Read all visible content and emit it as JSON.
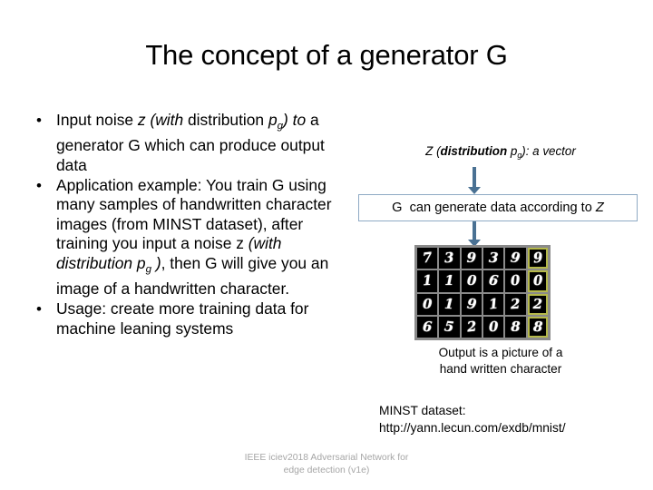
{
  "slide": {
    "title": "The concept of a generator G",
    "bullets": [
      {
        "id": "bullet-input-noise",
        "marker": "•",
        "segments": [
          {
            "text": "Input noise ",
            "style": "normal"
          },
          {
            "text": "z (with",
            "style": "italic"
          },
          {
            "text": " distribution ",
            "style": "normal"
          },
          {
            "text": "p",
            "style": "italic"
          },
          {
            "text": "g",
            "style": "sub"
          },
          {
            "text": ")",
            "style": "italic"
          },
          {
            "text": " ",
            "style": "normal"
          },
          {
            "text": "to",
            "style": "italic"
          },
          {
            "text": " a generator G which can produce output data",
            "style": "normal"
          }
        ],
        "plain": "Input noise z (with distribution pg) to a generator G which can produce output data"
      },
      {
        "id": "bullet-application-example",
        "marker": "•",
        "segments": [
          {
            "text": "Application example: You train G using many samples of handwritten character images (from MINST dataset), after training you input a noise z ",
            "style": "normal"
          },
          {
            "text": "(with distribution ",
            "style": "italic"
          },
          {
            "text": "p",
            "style": "italic"
          },
          {
            "text": "g",
            "style": "sub"
          },
          {
            "text": " )",
            "style": "italic"
          },
          {
            "text": ", then G will give you an image of a handwritten character.",
            "style": "normal"
          }
        ],
        "plain": "Application example: You train G using many samples of handwritten character images (from MINST dataset), after training you input a noise z (with distribution pg ), then G will give you an image of a handwritten character."
      },
      {
        "id": "bullet-usage",
        "marker": "•",
        "segments": [
          {
            "text": "Usage: create more training data for machine leaning systems",
            "style": "normal"
          }
        ],
        "plain": "Usage: create more training data for machine leaning systems"
      }
    ]
  },
  "diagram": {
    "z_label": {
      "prefix": "Z (",
      "bold": "distribution ",
      "p": "p",
      "sub": "g",
      "suffix": "): a vector",
      "plain": "Z (distribution pg): a vector"
    },
    "g_box": {
      "prefix": "G  can generate data according to ",
      "italic_tail": "Z",
      "plain": "G  can generate data according to Z",
      "border_color": "#8FAAC4"
    },
    "arrows": {
      "color": "#4A7193",
      "arrow_top_name": "arrow-z-to-g",
      "arrow_bottom_name": "arrow-g-to-output"
    },
    "output_caption_line1": "Output is a picture of a",
    "output_caption_line2": "hand written character"
  },
  "mnist_grid": {
    "background_color": "#8a8a8a",
    "highlight_color": "#b5b94a",
    "rows": 4,
    "cols": 6,
    "digits": [
      [
        "7",
        "3",
        "9",
        "3",
        "9",
        "9"
      ],
      [
        "1",
        "1",
        "0",
        "6",
        "0",
        "0"
      ],
      [
        "0",
        "1",
        "9",
        "1",
        "2",
        "2"
      ],
      [
        "6",
        "5",
        "2",
        "0",
        "8",
        "8"
      ]
    ],
    "highlighted_column": 5
  },
  "mnist_source": {
    "label": "MINST dataset:",
    "url": "http://yann.lecun.com/exdb/mnist/"
  },
  "footer": {
    "line1": "IEEE iciev2018 Adversarial Network for",
    "line2": "edge detection (v1e)",
    "color": "#a6a6a6"
  }
}
